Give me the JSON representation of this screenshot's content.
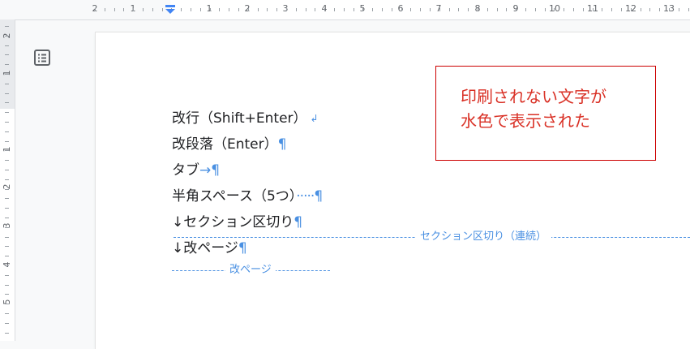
{
  "ruler": {
    "top_numbers": [
      "2",
      "1",
      "1",
      "2",
      "3",
      "4",
      "5",
      "6",
      "7",
      "8",
      "9",
      "10",
      "11",
      "12",
      "13"
    ],
    "left_numbers": [
      "2",
      "1",
      "1",
      "2",
      "3",
      "4",
      "5"
    ]
  },
  "document": {
    "lines": [
      {
        "text": "改行（Shift+Enter）",
        "mark": "↲"
      },
      {
        "text": "改段落（Enter）",
        "mark": "¶"
      },
      {
        "text": "タブ",
        "mark": "→¶"
      },
      {
        "text": "半角スペース（5つ）",
        "dots": "·····",
        "mark": "¶"
      },
      {
        "text": "↓セクション区切り",
        "mark": "¶"
      },
      {
        "text": "↓改ページ",
        "mark": "¶"
      }
    ],
    "section_break_label": "セクション区切り（連続）",
    "page_break_label": "改ページ"
  },
  "callout": {
    "line1": "印刷されない文字が",
    "line2": "水色で表示された"
  },
  "colors": {
    "formatting_marks": "#4a90e2",
    "callout_text": "#d93025",
    "callout_border": "#cc0000"
  }
}
